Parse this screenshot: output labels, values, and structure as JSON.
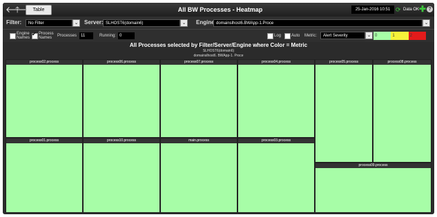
{
  "titlebar": {
    "back_icon": "back-arrow-icon",
    "up_icon": "up-arrow-icon",
    "table_button": "Table",
    "title": "All BW Processes - Heatmap",
    "date": "25-Jan-2016 10:51",
    "data_ok": "Data OK"
  },
  "filters": {
    "filter_label": "Filter:",
    "filter_value": "No Filter",
    "server_label": "Server:",
    "server_value": "SLHOST6(domain6)",
    "engine_label": "Engine:",
    "engine_value": "domainslhost6.BWApp-1.Proce"
  },
  "options": {
    "engine_names": [
      "Engine",
      "Names"
    ],
    "engine_names_checked": false,
    "process_names": [
      "Process",
      "Names"
    ],
    "process_names_checked": true,
    "processes_label": "Processes",
    "processes_value": "11",
    "running_label": "Running:",
    "running_value": "0",
    "log_label": "Log",
    "log_checked": false,
    "auto_label": "Auto",
    "auto_checked": false,
    "metric_label": "Metric:",
    "metric_value": "Alert Severity",
    "legend": [
      {
        "label": "0",
        "color": "#a7fda7"
      },
      {
        "label": "1",
        "color": "#f7f33a"
      },
      {
        "label": "2",
        "color": "#e31b1b"
      }
    ]
  },
  "heatmap": {
    "subtitle": "All Processes selected by Filter/Server/Engine where Color = Metric",
    "tooltip_line1": "SLHOST6(domain6)",
    "tooltip_line2": "domainslhost6. BWApp-1. Proce",
    "cell_color": "#a7fda7",
    "cells": [
      "process02.process",
      "process06.process",
      "process07.process",
      "process04.process",
      "process05.process",
      "process08.process",
      "process01.process",
      "process10.process",
      "main.process",
      "process03.process",
      "process09.process"
    ]
  }
}
